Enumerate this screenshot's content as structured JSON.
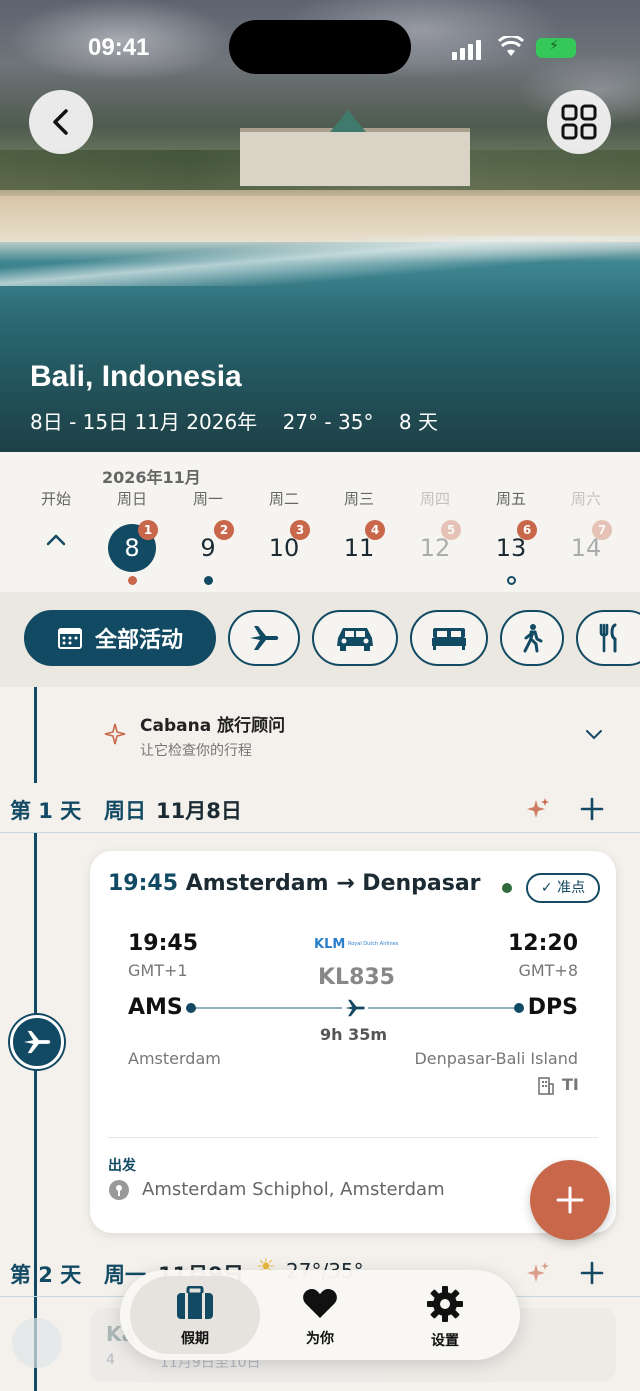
{
  "status": {
    "time": "09:41"
  },
  "hero": {
    "title": "Bali, Indonesia",
    "date_range": "8日 - 15日 11月 2026年",
    "temp_range": "27° - 35°",
    "duration": "8 天"
  },
  "calendar": {
    "month": "2026年11月",
    "start_label": "开始",
    "days": [
      {
        "weekday": "周日",
        "num": "8",
        "badge": "1",
        "selected": true,
        "dot": "filled-orange"
      },
      {
        "weekday": "周一",
        "num": "9",
        "badge": "2",
        "dot": "filled-blue"
      },
      {
        "weekday": "周二",
        "num": "10",
        "badge": "3",
        "dot": ""
      },
      {
        "weekday": "周三",
        "num": "11",
        "badge": "4",
        "dot": ""
      },
      {
        "weekday": "周四",
        "num": "12",
        "badge": "5",
        "faded": true,
        "dot": ""
      },
      {
        "weekday": "周五",
        "num": "13",
        "badge": "6",
        "dot": "hollow-blue"
      },
      {
        "weekday": "周六",
        "num": "14",
        "badge": "7",
        "faded": true,
        "dot": ""
      }
    ]
  },
  "filters": {
    "all_label": "全部活动",
    "icons": [
      "plane-icon",
      "car-icon",
      "bed-icon",
      "walk-icon",
      "restaurant-icon"
    ]
  },
  "advisor": {
    "title": "Cabana 旅行顾问",
    "subtitle": "让它检查你的行程"
  },
  "day1": {
    "label": "第 1 天",
    "weekday": "周日",
    "date": "11月8日"
  },
  "flight": {
    "time": "19:45",
    "route": "Amsterdam → Denpasar",
    "status": "✓ 准点",
    "dep_time": "19:45",
    "dep_tz": "GMT+1",
    "arr_time": "12:20",
    "arr_tz": "GMT+8",
    "airline_logo": "KLM",
    "airline_sub": "Royal Dutch Airlines",
    "flight_no": "KL835",
    "dep_code": "AMS",
    "arr_code": "DPS",
    "duration": "9h 35m",
    "dep_city": "Amsterdam",
    "arr_city": "Denpasar-Bali Island",
    "terminal": "TI",
    "section_label": "出发",
    "airport": "Amsterdam Schiphol, Amsterdam"
  },
  "day2": {
    "label": "第 2 天",
    "weekday": "周一",
    "date": "11月9日",
    "weather": "27°/35°"
  },
  "ghost_item": {
    "title": "Ka",
    "sub": "4",
    "sub2": "11月9日至10日"
  },
  "tabbar": {
    "tabs": [
      {
        "label": "假期",
        "icon": "suitcase-icon",
        "active": true
      },
      {
        "label": "为你",
        "icon": "heart-icon"
      },
      {
        "label": "设置",
        "icon": "gear-icon"
      }
    ]
  },
  "colors": {
    "primary": "#124a63",
    "accent": "#c8674a",
    "background": "#f4f1ec"
  }
}
